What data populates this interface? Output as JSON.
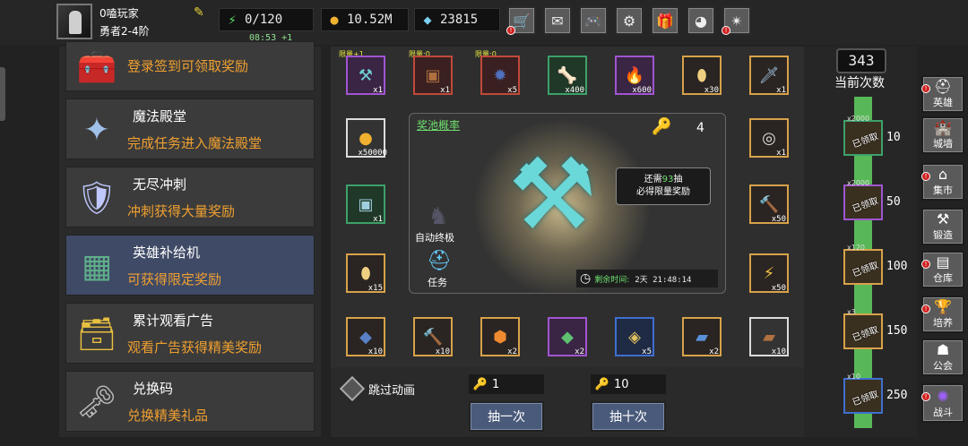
{
  "player": {
    "name": "0嗑玩家",
    "rank": "勇者2-4阶"
  },
  "resources": {
    "stamina": "0/120",
    "stamina_timer": "08:53 +1",
    "gold": "10.52M",
    "gems": "23815"
  },
  "menu": [
    {
      "title": "",
      "subtitle": "登录签到可领取奖励",
      "icon": "chest-icon"
    },
    {
      "title": "魔法殿堂",
      "subtitle": "完成任务进入魔法殿堂",
      "icon": "crystal-hall-icon"
    },
    {
      "title": "无尽冲刺",
      "subtitle": "冲刺获得大量奖励",
      "icon": "shield-icon"
    },
    {
      "title": "英雄补给机",
      "subtitle": "可获得限定奖励",
      "icon": "supply-machine-icon"
    },
    {
      "title": "累计观看广告",
      "subtitle": "观看广告获得精美奖励",
      "icon": "treasure-chest-icon"
    },
    {
      "title": "兑换码",
      "subtitle": "兑换精美礼品",
      "icon": "key-icon"
    }
  ],
  "limits": [
    "限量+1",
    "限量:0",
    "限量:0"
  ],
  "slots": [
    {
      "count": "x1",
      "icon": "axe-icon",
      "rarity": "purple"
    },
    {
      "count": "x1",
      "icon": "chest-icon",
      "rarity": "red"
    },
    {
      "count": "x5",
      "icon": "ore-icon",
      "rarity": "red"
    },
    {
      "count": "x400",
      "icon": "bone-icon",
      "rarity": "green"
    },
    {
      "count": "x600",
      "icon": "fire-scroll-icon",
      "rarity": "purple"
    },
    {
      "count": "x30",
      "icon": "egg-icon",
      "rarity": "orange"
    },
    {
      "count": "x1",
      "icon": "dagger-icon",
      "rarity": "orange"
    },
    {
      "count": "x50000",
      "icon": "gold-coin-icon",
      "rarity": "white"
    },
    {
      "count": "x1",
      "icon": "ring-icon",
      "rarity": "orange"
    },
    {
      "count": "x1",
      "icon": "chest-icon",
      "rarity": "green"
    },
    {
      "count": "x50",
      "icon": "hammer-icon",
      "rarity": "orange"
    },
    {
      "count": "x15",
      "icon": "egg-icon",
      "rarity": "orange"
    },
    {
      "count": "x50",
      "icon": "lightning-icon",
      "rarity": "orange"
    },
    {
      "count": "x10",
      "icon": "blue-ore-icon",
      "rarity": "orange"
    },
    {
      "count": "x10",
      "icon": "hammer-icon",
      "rarity": "orange"
    },
    {
      "count": "x2",
      "icon": "orange-gem-icon",
      "rarity": "orange"
    },
    {
      "count": "x2",
      "icon": "green-gem-icon",
      "rarity": "purple"
    },
    {
      "count": "x5",
      "icon": "rune-icon",
      "rarity": "blue"
    },
    {
      "count": "x2",
      "icon": "blue-book-icon",
      "rarity": "orange"
    },
    {
      "count": "x10",
      "icon": "brown-book-icon",
      "rarity": "white"
    }
  ],
  "pool": {
    "title": "奖池概率",
    "key_count": "4",
    "tip_line1_pre": "还需",
    "tip_num": "93",
    "tip_line1_post": "抽",
    "tip_line2": "必得限量奖励",
    "auto": "自动终极",
    "task": "任务",
    "remain_label": "剩余时间:",
    "remain_time": "2天 21:48:14"
  },
  "bottom": {
    "skip": "跳过动画",
    "qty1": "1",
    "qty10": "10",
    "draw1": "抽一次",
    "draw10": "抽十次"
  },
  "progress": {
    "count": "343",
    "label": "当前次数",
    "milestones": [
      {
        "n": "10",
        "stamp": "已领取",
        "qty": "x2000"
      },
      {
        "n": "50",
        "stamp": "已领取",
        "qty": "x2000"
      },
      {
        "n": "100",
        "stamp": "已领取",
        "qty": "x120"
      },
      {
        "n": "150",
        "stamp": "已领取",
        "qty": "x3"
      },
      {
        "n": "250",
        "stamp": "已领取",
        "qty": "x10"
      }
    ]
  },
  "nav": [
    "英雄",
    "城墙",
    "集市",
    "锻造",
    "仓库",
    "培养",
    "公会",
    "战斗"
  ]
}
